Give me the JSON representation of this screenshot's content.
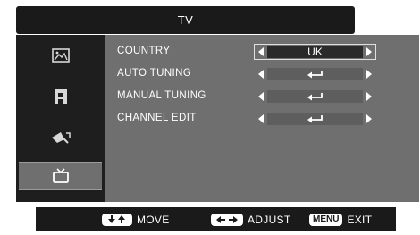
{
  "header": {
    "title": "TV"
  },
  "sidebar": {
    "items": [
      {
        "icon": "picture-icon",
        "selected": false
      },
      {
        "icon": "sound-icon",
        "selected": false
      },
      {
        "icon": "setup-icon",
        "selected": false
      },
      {
        "icon": "tv-icon",
        "selected": true
      }
    ]
  },
  "menu": {
    "rows": [
      {
        "label": "COUNTRY",
        "value": "UK",
        "type": "select",
        "highlighted": true
      },
      {
        "label": "AUTO TUNING",
        "value": "",
        "type": "enter-icon",
        "highlighted": false
      },
      {
        "label": "MANUAL TUNING",
        "value": "",
        "type": "enter-icon",
        "highlighted": false
      },
      {
        "label": "CHANNEL EDIT",
        "value": "",
        "type": "enter-icon",
        "highlighted": false
      }
    ]
  },
  "footer": {
    "move_label": "MOVE",
    "adjust_label": "ADJUST",
    "menu_key": "MENU",
    "exit_label": "EXIT"
  },
  "colors": {
    "title_bg": "#1a1a1a",
    "panel_bg": "#6f6f6f",
    "field_bg": "#5e5e5e",
    "text": "#ffffff"
  }
}
